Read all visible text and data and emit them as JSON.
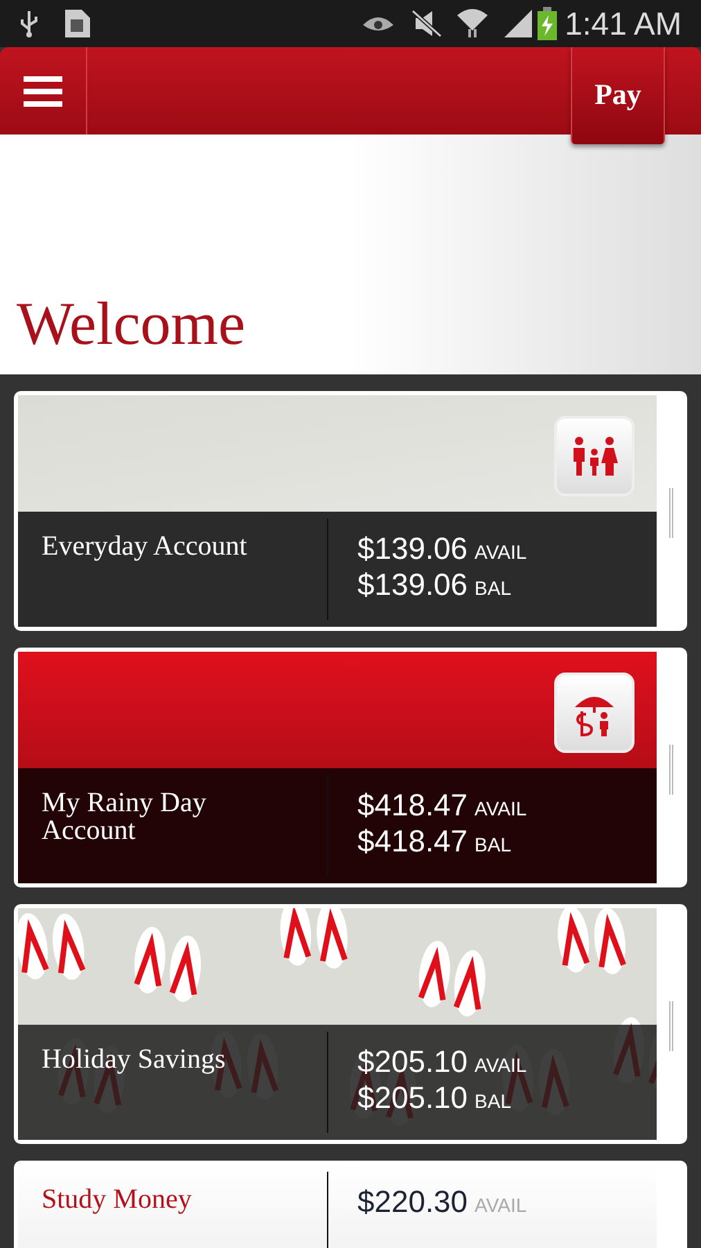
{
  "status_bar": {
    "time": "1:41 AM"
  },
  "header": {
    "pay_button": "Pay"
  },
  "title": "Welcome",
  "accounts": [
    {
      "kind": "plain",
      "name": "Everyday Account",
      "avail": "$139.06",
      "avail_label": "AVAIL",
      "bal": "$139.06",
      "bal_label": "BAL"
    },
    {
      "kind": "red",
      "name": "My Rainy Day Account",
      "avail": "$418.47",
      "avail_label": "AVAIL",
      "bal": "$418.47",
      "bal_label": "BAL"
    },
    {
      "kind": "pattern",
      "name": "Holiday Savings",
      "avail": "$205.10",
      "avail_label": "AVAIL",
      "bal": "$205.10",
      "bal_label": "BAL"
    },
    {
      "kind": "light",
      "name": "Study Money",
      "avail": "$220.30",
      "avail_label": "AVAIL"
    }
  ]
}
